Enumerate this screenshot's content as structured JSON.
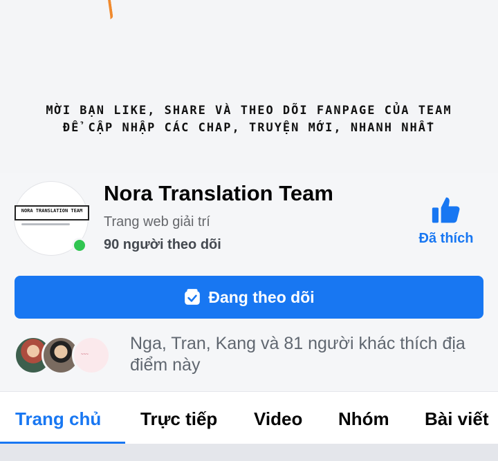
{
  "banner": {
    "line1": "Mời bạn like, share và theo dõi fanpage của team",
    "line2": "để cập nhập các chap, truyện mới, nhanh nhất"
  },
  "page": {
    "avatar_logo_text": "NORA TRANSLATION TEAM",
    "name": "Nora Translation Team",
    "category": "Trang web giải trí",
    "followers": "90 người theo dõi"
  },
  "like": {
    "label": "Đã thích",
    "icon": "thumbs-up-icon"
  },
  "follow_button": {
    "label": "Đang theo dõi",
    "icon": "following-check-icon"
  },
  "friends": {
    "text": "Nga, Tran, Kang và 81 người khác thích địa điểm này"
  },
  "tabs": [
    {
      "label": "Trang chủ",
      "active": true
    },
    {
      "label": "Trực tiếp",
      "active": false
    },
    {
      "label": "Video",
      "active": false
    },
    {
      "label": "Nhóm",
      "active": false
    },
    {
      "label": "Bài viết",
      "active": false
    }
  ],
  "colors": {
    "accent": "#1877f2",
    "online": "#31c551"
  }
}
